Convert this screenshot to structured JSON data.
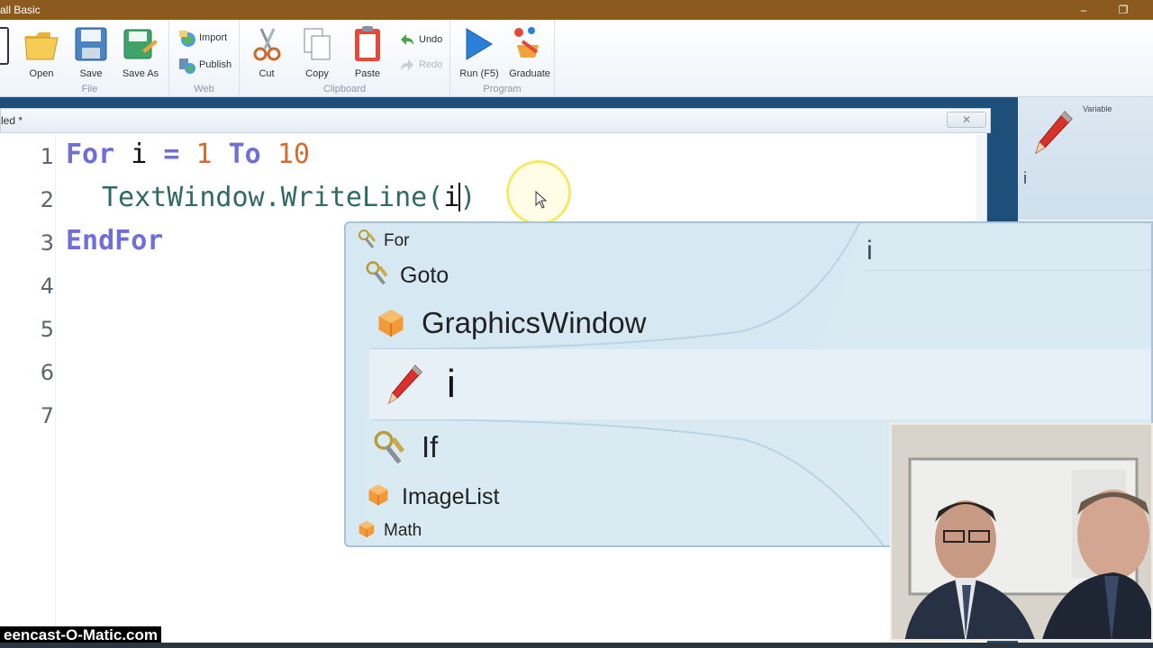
{
  "window": {
    "title": "all Basic",
    "controls": [
      "–",
      "❐"
    ]
  },
  "ribbon": {
    "groups": [
      {
        "label": "File",
        "buttons": [
          "Open",
          "Save",
          "Save As"
        ]
      },
      {
        "label": "Web",
        "buttons": [
          "Import",
          "Publish"
        ]
      },
      {
        "label": "Clipboard",
        "buttons": [
          "Cut",
          "Copy",
          "Paste",
          "Undo",
          "Redo"
        ]
      },
      {
        "label": "Program",
        "buttons": [
          "Run (F5)",
          "Graduate"
        ]
      }
    ],
    "icons": [
      "open-folder-icon",
      "save-icon",
      "save-as-icon",
      "import-icon",
      "publish-icon",
      "cut-icon",
      "copy-icon",
      "paste-icon",
      "undo-icon",
      "redo-icon",
      "run-icon",
      "graduate-icon"
    ]
  },
  "document": {
    "tab_title": "led *",
    "close_glyph": "✕",
    "line_numbers": [
      "1",
      "2",
      "3",
      "4",
      "5",
      "6",
      "7"
    ],
    "code": {
      "line1": {
        "kw_for": "For",
        "var": "i",
        "eq": "=",
        "start": "1",
        "kw_to": "To",
        "end": "10"
      },
      "line2": {
        "call": "TextWindow.WriteLine(",
        "arg": "i",
        "close": ")"
      },
      "line3": {
        "kw_endfor": "EndFor"
      }
    }
  },
  "intellisense": {
    "items": [
      {
        "label": "For",
        "icon": "keyword-keys-icon"
      },
      {
        "label": "Goto",
        "icon": "keyword-keys-icon"
      },
      {
        "label": "GraphicsWindow",
        "icon": "object-cube-icon"
      },
      {
        "label": "i",
        "icon": "variable-pencil-icon",
        "selected": true
      },
      {
        "label": "If",
        "icon": "keyword-keys-icon"
      },
      {
        "label": "ImageList",
        "icon": "object-cube-icon"
      },
      {
        "label": "Math",
        "icon": "object-cube-icon"
      }
    ],
    "description_name": "i"
  },
  "help_panel": {
    "type_label": "Variable",
    "name": "i",
    "icon": "variable-pencil-icon"
  },
  "overlay": {
    "watermark": "eencast-O-Matic.com"
  },
  "colors": {
    "keyword": "#6f6fd6",
    "number": "#d36d2f",
    "object_call": "#2f6a66",
    "popup_bg": "#d6e8f2",
    "titlebar": "#8a5a1e"
  }
}
